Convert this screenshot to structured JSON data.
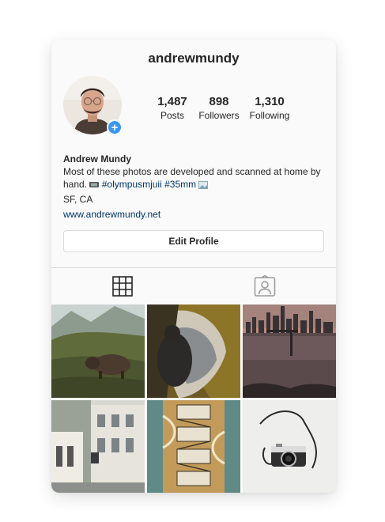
{
  "profile": {
    "username": "andrewmundy",
    "avatar_icon": "avatar-photo",
    "add_icon": "plus-icon"
  },
  "stats": {
    "posts": {
      "value": "1,487",
      "label": "Posts"
    },
    "followers": {
      "value": "898",
      "label": "Followers"
    },
    "following": {
      "value": "1,310",
      "label": "Following"
    }
  },
  "bio": {
    "name": "Andrew Mundy",
    "line1": "Most of these photos are developed and scanned at home by",
    "line2_prefix": "hand.",
    "hashtag1": "#olympusmjuii",
    "hashtag2": "#35mm",
    "location": "SF, CA",
    "website": "www.andrewmundy.net"
  },
  "actions": {
    "edit_profile": "Edit Profile"
  },
  "tabs": [
    {
      "icon": "grid-icon",
      "active": true
    },
    {
      "icon": "tagged-person-icon",
      "active": false
    }
  ],
  "colors": {
    "link": "#003569",
    "badge": "#3897f0",
    "text": "#262626",
    "border": "#dbdbdb"
  }
}
